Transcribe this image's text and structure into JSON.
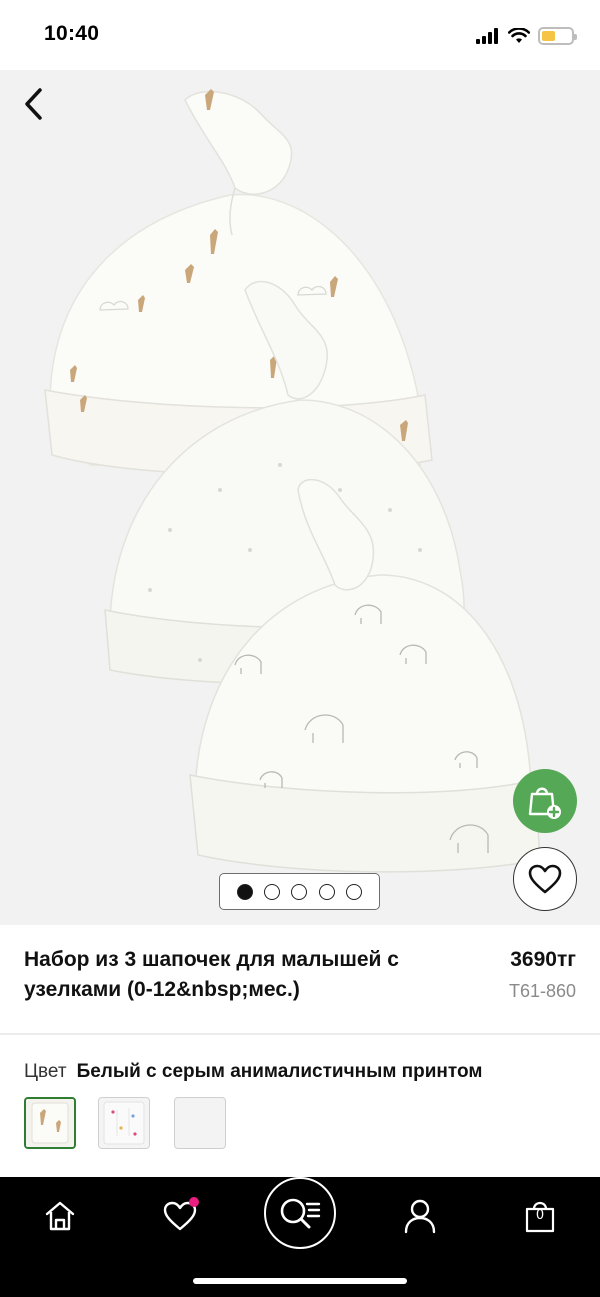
{
  "status_bar": {
    "time": "10:40",
    "icons": [
      "signal-icon",
      "wifi-icon",
      "battery-icon"
    ],
    "battery_color": "#f6c445"
  },
  "gallery": {
    "image": "product-photo-three-knotted-baby-hats",
    "page_count": 5,
    "active_page": 1,
    "back_icon": "chevron-left-icon",
    "add_to_bag_icon": "bag-plus-icon",
    "wishlist_icon": "heart-icon",
    "accent_color": "#55a855"
  },
  "product": {
    "title": "Набор из 3 шапочек для малышей с узелками (0-12&nbsp;мес.)",
    "price": "3690тг",
    "code": "T61-860"
  },
  "color": {
    "label": "Цвет",
    "value": "Белый с серым анималистичным принтом",
    "swatches": [
      {
        "name": "giraffe-print",
        "selected": true
      },
      {
        "name": "multi-print",
        "selected": false
      },
      {
        "name": "plain-grey",
        "selected": false
      }
    ],
    "selected_border_color": "#2e7d32"
  },
  "tab_bar": {
    "items": [
      "home-icon",
      "heart-icon",
      "search-icon",
      "user-icon",
      "bag-icon"
    ],
    "bag_count": "0",
    "wishlist_badge_color": "#e91e80"
  }
}
